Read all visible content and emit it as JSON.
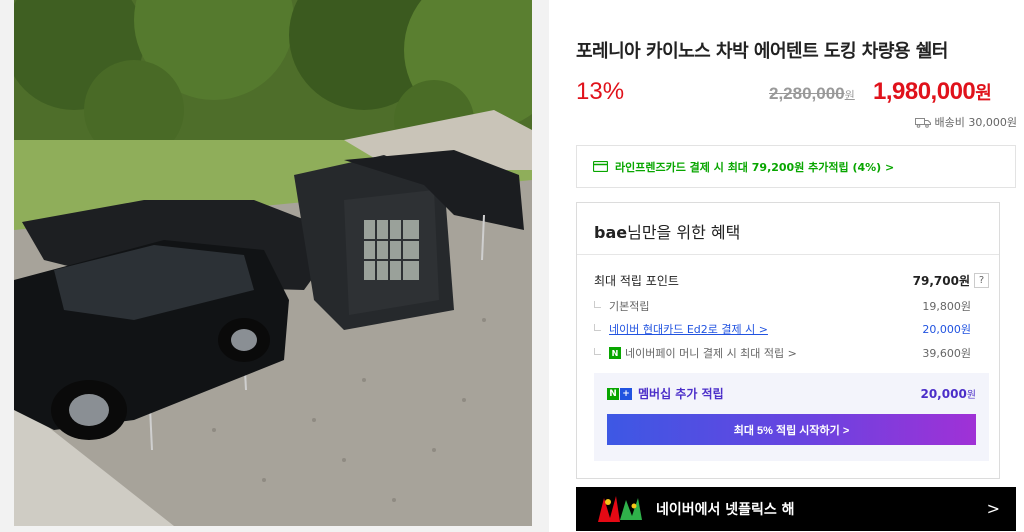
{
  "product": {
    "title": "포레니아 카이노스 차박 에어텐트 도킹 차량용 쉘터",
    "discount": "13%",
    "original_price": "2,280,000",
    "original_unit": "원",
    "price": "1,980,000",
    "price_unit": "원",
    "shipping": "배송비 30,000원"
  },
  "card_promo": {
    "text": "라인프렌즈카드 결제 시 최대 79,200원 추가적립 (4%) >"
  },
  "benefit": {
    "user": "bae",
    "title_suffix": "님만을 위한 혜택",
    "max_label": "최대 적립 포인트",
    "max_value": "79,700원",
    "help": "?",
    "rows": [
      {
        "label": "기본적립",
        "value": "19,800원"
      },
      {
        "label": "네이버 현대카드 Ed2로 결제 시 >",
        "value": "20,000원"
      },
      {
        "badge": "N",
        "label": "네이버페이 머니 결제 시 최대 적립 >",
        "value": "39,600원"
      }
    ],
    "member": {
      "badge_n": "N",
      "badge_plus": "+",
      "label": "멤버십 추가 적립",
      "value": "20,000",
      "value_unit": "원",
      "button": "최대 5% 적립 시작하기 >"
    }
  },
  "banner": {
    "text": "네이버에서 넷플릭스 해",
    "arrow": ">"
  },
  "colors": {
    "price_red": "#e0121b",
    "naver_green": "#08a600",
    "link_blue": "#2153e0",
    "member_purple": "#4b2ec9"
  }
}
